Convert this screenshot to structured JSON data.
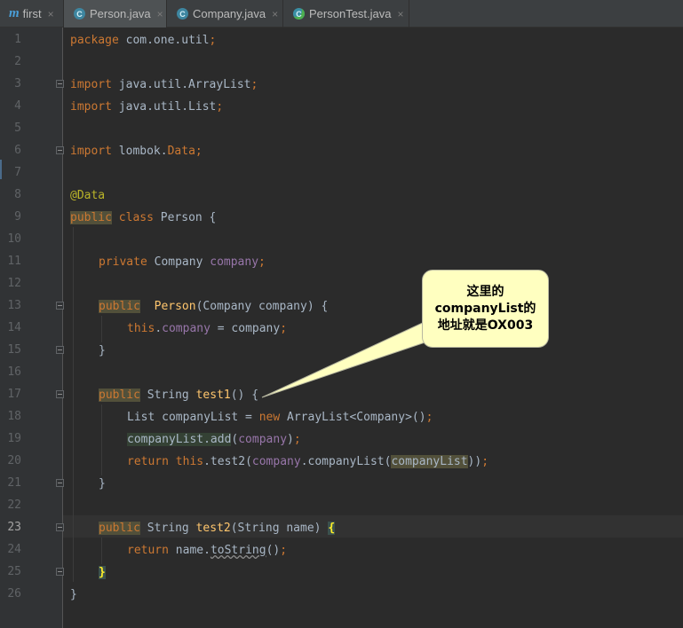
{
  "tabs": [
    {
      "label": "first",
      "icon": "module-m-icon"
    },
    {
      "label": "Person.java",
      "icon": "class-c-icon",
      "active": true
    },
    {
      "label": "Company.java",
      "icon": "class-c-icon"
    },
    {
      "label": "PersonTest.java",
      "icon": "test-class-icon"
    }
  ],
  "close_glyph": "×",
  "line_numbers": [
    "1",
    "2",
    "3",
    "4",
    "5",
    "6",
    "7",
    "8",
    "9",
    "10",
    "11",
    "12",
    "13",
    "14",
    "15",
    "16",
    "17",
    "18",
    "19",
    "20",
    "21",
    "22",
    "23",
    "24",
    "25",
    "26"
  ],
  "code": {
    "l1_kw": "package",
    "l1_rest": " com.one.util",
    "l3_kw": "import",
    "l3_rest": " java.util.ArrayList",
    "l4_kw": "import",
    "l4_rest": " java.util.List",
    "l6_kw": "import",
    "l6_rest": " lombok.",
    "l6_cls": "Data",
    "semi": ";",
    "l8_ann": "@Data",
    "l9_kw1": "public",
    "l9_kw2": "class",
    "l9_rest": " Person {",
    "l11_kw": "private",
    "l11_type": " Company ",
    "l11_field": "company",
    "l13_kw": "public",
    "l13_fn": "Person",
    "l13_rest": "(Company company) {",
    "l14_this": "this",
    "l14_dot": ".",
    "l14_field": "company",
    "l14_rest": " = company",
    "close_brace": "}",
    "l17_kw": "public",
    "l17_type": " String ",
    "l17_fn": "test1",
    "l17_rest": "() {",
    "l18_a": "List companyList = ",
    "l18_new": "new",
    "l18_b": " ArrayList<Company>()",
    "l19_a": "companyList.add",
    "l19_b": "(",
    "l19_field": "company",
    "l19_c": ")",
    "l20_ret": "return",
    "l20_this": " this",
    "l20_a": ".test2(",
    "l20_field": "company",
    "l20_b": ".companyList(",
    "l20_c": "companyList",
    "l20_d": "))",
    "l23_kw": "public",
    "l23_type": " String ",
    "l23_fn": "test2",
    "l23_rest": "(String name) ",
    "open_brace": "{",
    "l24_ret": "return",
    "l24_a": " name.",
    "l24_call": "toString",
    "l24_b": "()"
  },
  "callout": {
    "line1": "这里的",
    "line2": "companyList的",
    "line3": "地址就是OX003"
  },
  "colors": {
    "background": "#2b2b2b",
    "keyword": "#cc7832",
    "field": "#9876aa",
    "method": "#ffc66d",
    "annotation": "#bbb529",
    "callout_bg": "#ffffc0"
  }
}
